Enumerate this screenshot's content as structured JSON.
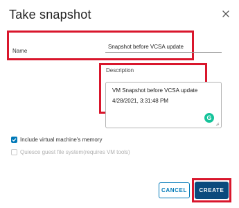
{
  "dialog": {
    "title": "Take snapshot",
    "close_icon": "close-icon"
  },
  "form": {
    "name_label": "Name",
    "name_value": "Snapshot before VCSA update",
    "description_label": "Description",
    "description_lines": [
      "VM Snapshot before VCSA update",
      "4/28/2021, 3:31:48 PM"
    ],
    "grammarly_icon": "G"
  },
  "options": {
    "include_memory_label": "Include virtual machine's memory",
    "include_memory_checked": true,
    "quiesce_label": "Quiesce guest file system(requires VM tools)",
    "quiesce_checked": false,
    "quiesce_enabled": false
  },
  "buttons": {
    "cancel_label": "CANCEL",
    "create_label": "CREATE"
  },
  "colors": {
    "highlight": "#d9162c",
    "primary": "#0b4a7d",
    "accent": "#0079b8",
    "grammarly": "#15c39a"
  }
}
